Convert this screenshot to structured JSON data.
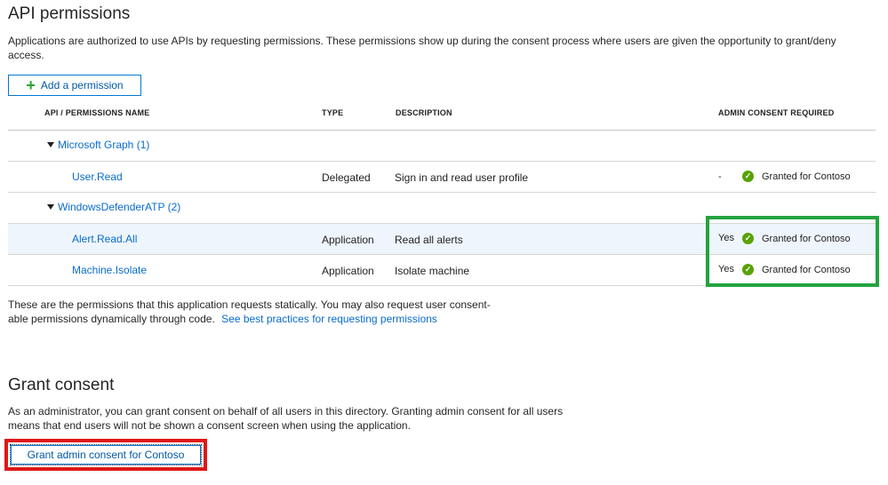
{
  "api_permissions": {
    "title": "API permissions",
    "description": "Applications are authorized to use APIs by requesting permissions. These permissions show up during the consent process where users are given the opportunity to grant/deny access.",
    "add_button_label": "Add a permission"
  },
  "table": {
    "headers": {
      "api": "API / PERMISSIONS NAME",
      "type": "TYPE",
      "description": "DESCRIPTION",
      "admin_consent": "ADMIN CONSENT REQUIRED"
    },
    "groups": [
      {
        "name": "Microsoft Graph (1)",
        "permissions": [
          {
            "name": "User.Read",
            "type": "Delegated",
            "description": "Sign in and read user profile",
            "admin_required": "-",
            "status": "Granted for Contoso"
          }
        ]
      },
      {
        "name": "WindowsDefenderATP (2)",
        "permissions": [
          {
            "name": "Alert.Read.All",
            "type": "Application",
            "description": "Read all alerts",
            "admin_required": "Yes",
            "status": "Granted for Contoso"
          },
          {
            "name": "Machine.Isolate",
            "type": "Application",
            "description": "Isolate machine",
            "admin_required": "Yes",
            "status": "Granted for Contoso"
          }
        ]
      }
    ]
  },
  "footer_note": {
    "line1": "These are the permissions that this application requests statically. You may also request user consent-",
    "line2": "able permissions dynamically through code.",
    "link": "See best practices for requesting permissions"
  },
  "grant_consent": {
    "title": "Grant consent",
    "line1": "As an administrator, you can grant consent on behalf of all users in this directory. Granting admin consent for all users",
    "line2": "means that end users will not be shown a consent screen when using the application.",
    "button_label": "Grant admin consent for Contoso"
  },
  "colors": {
    "accent": "#0078d4",
    "link": "#0a6ccd",
    "success": "#57a300",
    "highlight_green": "#23a33f",
    "highlight_red": "#e01818"
  },
  "icons": {
    "add": "plus-icon",
    "expand": "caret-down-icon",
    "status": "check-circle-icon"
  }
}
